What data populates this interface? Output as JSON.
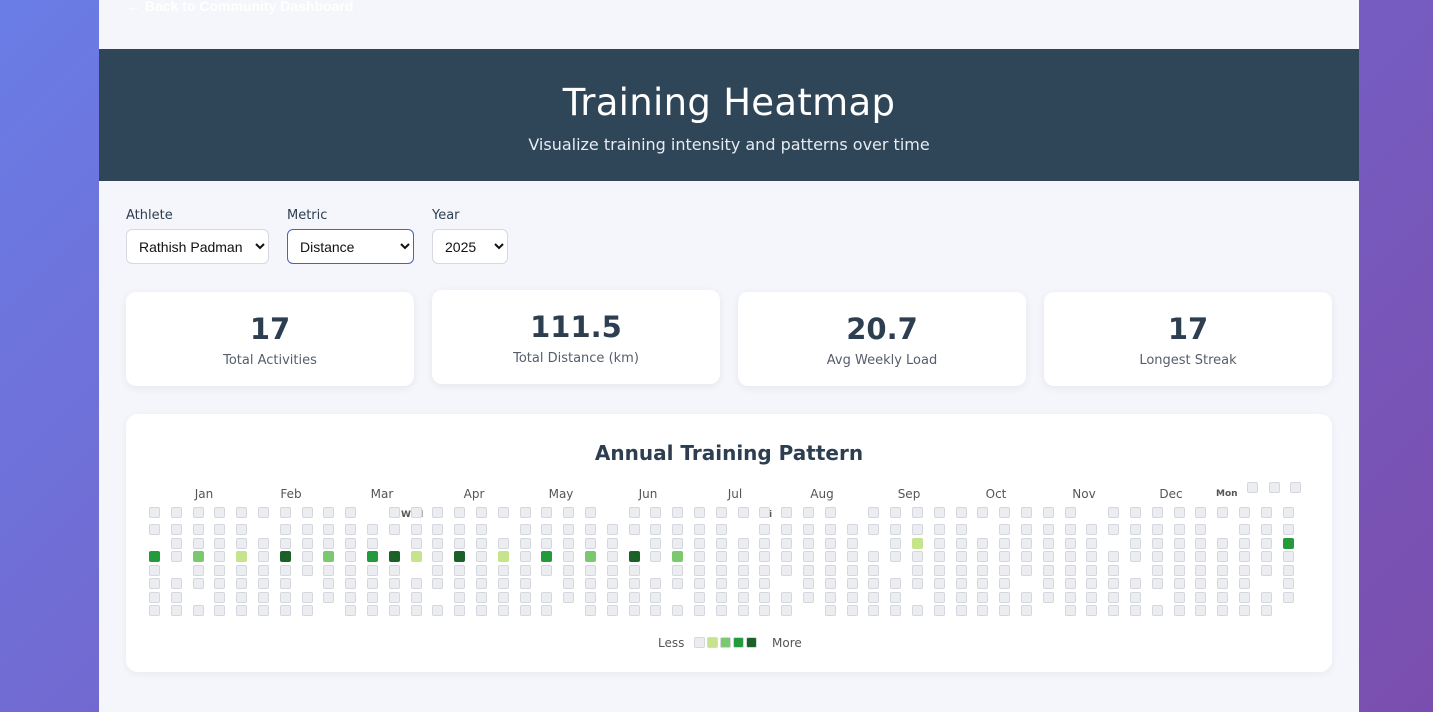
{
  "nav": {
    "back_label": "← Back to Community Dashboard"
  },
  "header": {
    "title": "Training Heatmap",
    "subtitle": "Visualize training intensity and patterns over time"
  },
  "filters": {
    "athlete": {
      "label": "Athlete",
      "value": "Rathish Padman"
    },
    "metric": {
      "label": "Metric",
      "value": "Distance"
    },
    "year": {
      "label": "Year",
      "value": "2025"
    }
  },
  "stats": [
    {
      "value": "17",
      "label": "Total Activities"
    },
    {
      "value": "111.5",
      "label": "Total Distance (km)"
    },
    {
      "value": "20.7",
      "label": "Avg Weekly Load"
    },
    {
      "value": "17",
      "label": "Longest Streak"
    }
  ],
  "heatmap": {
    "title": "Annual Training Pattern",
    "months": [
      "Jan",
      "Feb",
      "Mar",
      "Apr",
      "May",
      "Jun",
      "Jul",
      "Aug",
      "Sep",
      "Oct",
      "Nov",
      "Dec"
    ],
    "day_labels": [
      "Mon",
      "Wed",
      "Fri"
    ],
    "legend_less": "Less",
    "legend_more": "More",
    "colors": {
      "empty": "#ebedf0",
      "level1": "#c6e48b",
      "level2": "#7bc96f",
      "level3": "#239a3b",
      "level4": "#196127"
    },
    "active_weeks": [
      {
        "week": 0,
        "level": 3
      },
      {
        "week": 2,
        "level": 2
      },
      {
        "week": 4,
        "level": 1
      },
      {
        "week": 6,
        "level": 4
      },
      {
        "week": 8,
        "level": 2
      },
      {
        "week": 10,
        "level": 3
      },
      {
        "week": 11,
        "level": 4
      },
      {
        "week": 12,
        "level": 1
      },
      {
        "week": 14,
        "level": 4
      },
      {
        "week": 16,
        "level": 1
      },
      {
        "week": 18,
        "level": 3
      },
      {
        "week": 20,
        "level": 2
      },
      {
        "week": 22,
        "level": 4
      },
      {
        "week": 24,
        "level": 2
      },
      {
        "week": 35,
        "level": 1
      },
      {
        "week": 52,
        "level": 3
      }
    ]
  }
}
